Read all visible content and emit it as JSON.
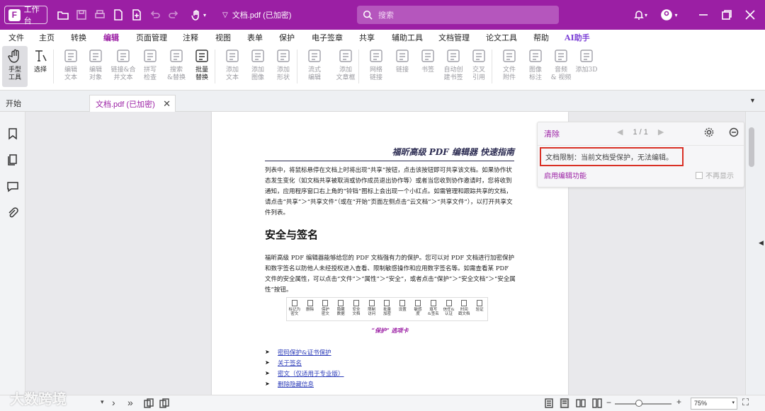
{
  "titlebar": {
    "workspace_label": "工作台",
    "doc_title": "文档.pdf (已加密)",
    "search_placeholder": "搜索"
  },
  "menu": {
    "items": [
      "文件",
      "主页",
      "转换",
      "编辑",
      "页面管理",
      "注释",
      "视图",
      "表单",
      "保护",
      "电子签章",
      "共享",
      "辅助工具",
      "文档管理",
      "论文工具",
      "帮助",
      "AI助手"
    ],
    "active": "编辑"
  },
  "toolbar": {
    "tools": [
      {
        "label": "手型\n工具",
        "icon": "hand-icon"
      },
      {
        "label": "选择",
        "icon": "select-text-icon"
      },
      {
        "label": "编辑\n文本",
        "icon": "edit-text-icon"
      },
      {
        "label": "编辑\n对象",
        "icon": "edit-object-icon"
      },
      {
        "label": "链接&合\n并文本",
        "icon": "link-merge-icon"
      },
      {
        "label": "拼写\n检查",
        "icon": "spell-check-icon"
      },
      {
        "label": "搜索\n&替换",
        "icon": "search-replace-icon"
      },
      {
        "label": "批量\n替换",
        "icon": "batch-replace-icon"
      },
      {
        "label": "添加\n文本",
        "icon": "add-text-icon"
      },
      {
        "label": "添加\n图像",
        "icon": "add-image-icon"
      },
      {
        "label": "添加\n形状",
        "icon": "add-shape-icon"
      },
      {
        "label": "流式\n编辑",
        "icon": "flow-edit-icon"
      },
      {
        "label": "添加\n文章框",
        "icon": "article-box-icon"
      },
      {
        "label": "网络\n链接",
        "icon": "web-link-icon"
      },
      {
        "label": "链接",
        "icon": "link-icon"
      },
      {
        "label": "书签",
        "icon": "bookmark-icon"
      },
      {
        "label": "自动创\n建书签",
        "icon": "auto-bookmark-icon"
      },
      {
        "label": "交叉\n引用",
        "icon": "cross-ref-icon"
      },
      {
        "label": "文件\n附件",
        "icon": "file-attach-icon"
      },
      {
        "label": "图像\n标注",
        "icon": "image-annotate-icon"
      },
      {
        "label": "音频\n& 视频",
        "icon": "audio-video-icon"
      },
      {
        "label": "添加3D",
        "icon": "add-3d-icon"
      }
    ]
  },
  "tabs": {
    "start": "开始",
    "doc": "文档.pdf (已加密)"
  },
  "page": {
    "header": "福昕高级 PDF 编辑器  快速指南",
    "para1": "列表中，将鼠标悬停在文档上时将出现“共享”按钮，点击该按钮即可共享该文档。如果协作状态发生变化（如文档共享被取消或协作成员退出协作等）或者当您收到协作邀请时，您将收到通知，应用程序窗口右上角的“铃铛”图标上会出现一个小红点。如需管理和跟踪共享的文档，请点击“共享”＞“共享文件”（或在“开始”页面左侧点击“云文档”＞“共享文件”），以打开共享文件列表。",
    "heading": "安全与签名",
    "para2": "福昕高级 PDF 编辑器能够给您的 PDF 文档强有力的保护。您可以对 PDF 文档进行加密保护和数字签名以防他人未经授权进入查看、限制敏感操作和应用数字签名等。如需查看某 PDF 文件的安全属性，可以点击“文件”＞“属性”＞“安全”，或者点击“保护”＞“安全文档”＞“安全属性”按钮。",
    "protect_items": [
      "标记为\n密文",
      "删除",
      "保护\n密文",
      "隐藏\n数据",
      "安全\n文档",
      "限制\n访问",
      "批量\n加密",
      "设置",
      "敏感\n度",
      "填写\n&签名",
      "信任&\n认证",
      "时间\n戳文档",
      "验证"
    ],
    "caption": "“保护” 选项卡",
    "links": [
      "密码保护&证书保护",
      "关于签名",
      "密文（仅适用于专业版）",
      "删除隐藏信息"
    ]
  },
  "notice": {
    "clear": "清除",
    "pager": "1 / 1",
    "message": "文档限制：当前文档受保护，无法编辑。",
    "enable": "启用编辑功能",
    "no_more": "不再显示"
  },
  "status": {
    "zoom": "75%"
  },
  "watermark": "大数跨境"
}
